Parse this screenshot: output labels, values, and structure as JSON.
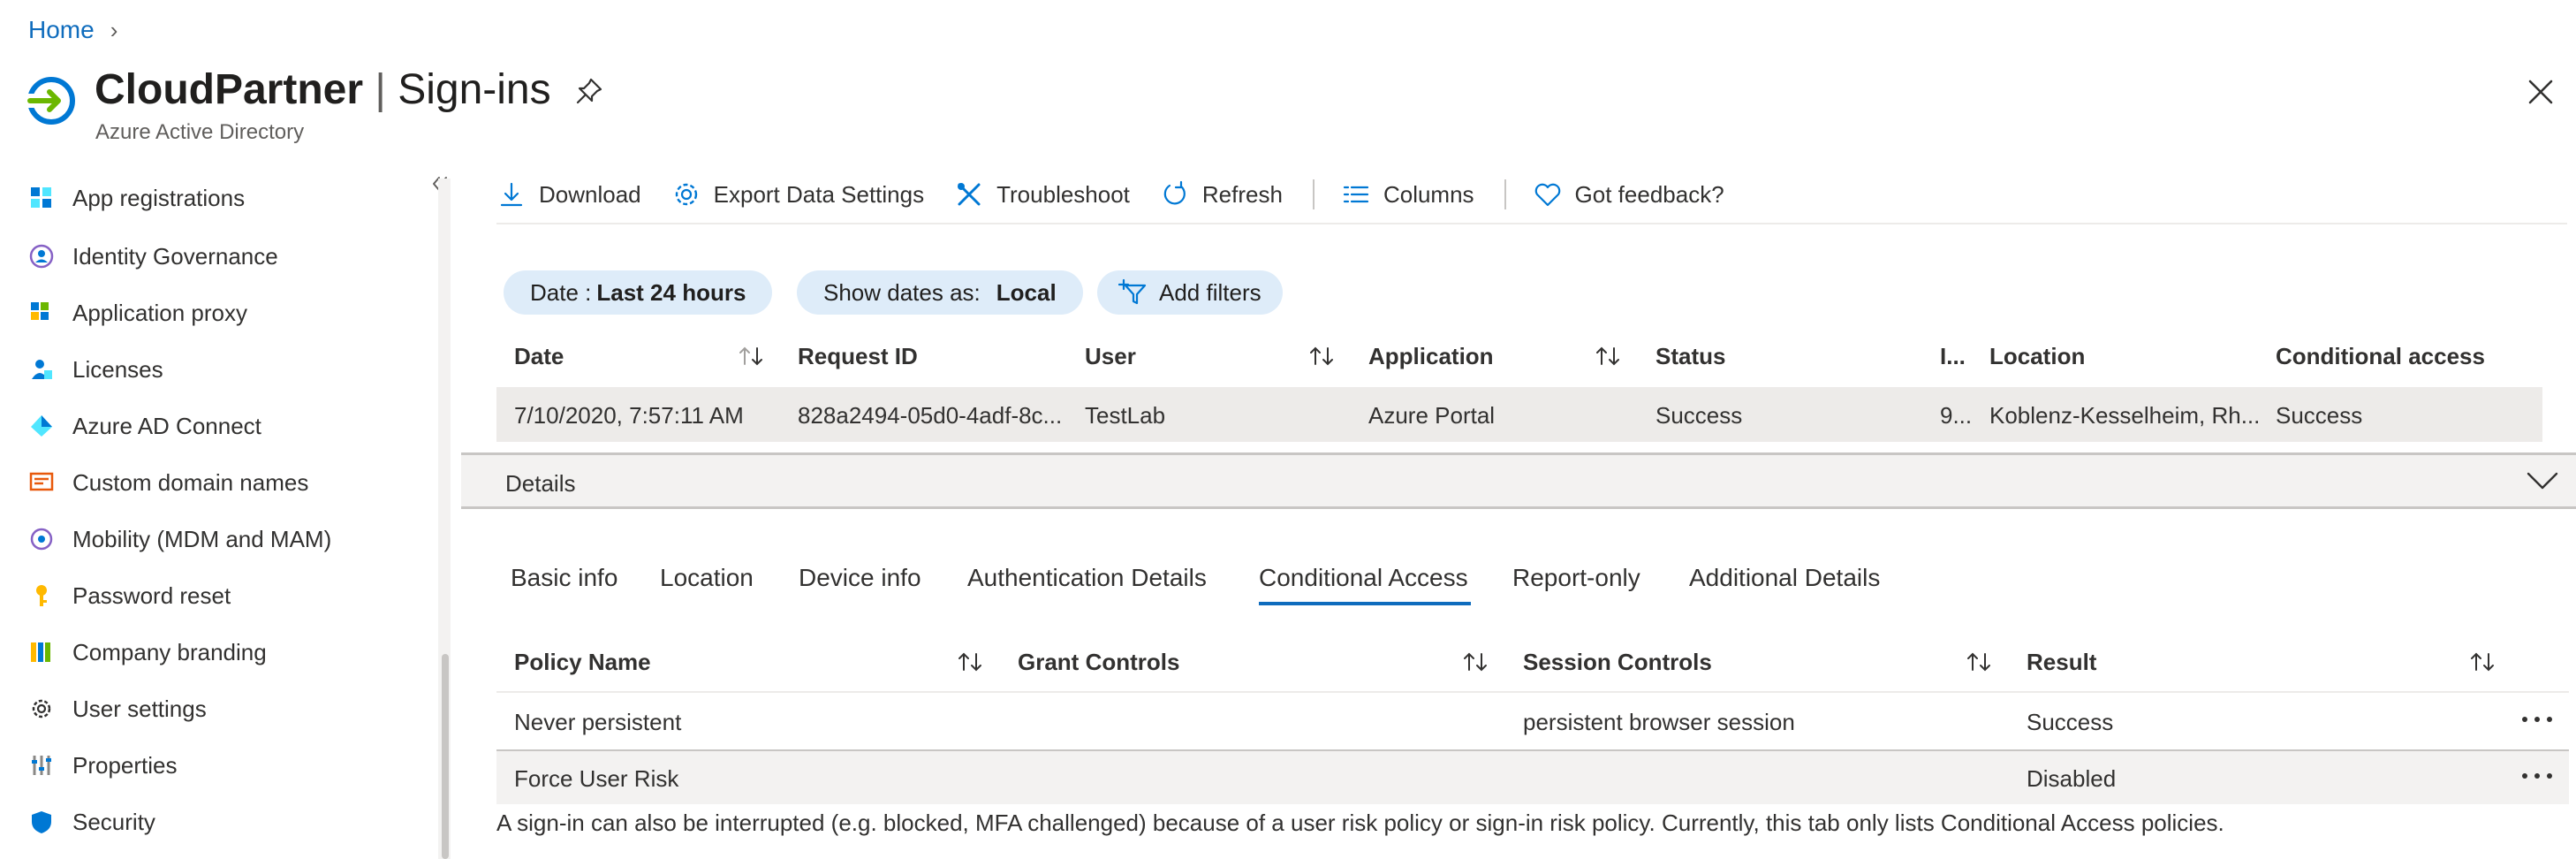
{
  "breadcrumb": {
    "home": "Home",
    "separator": "›"
  },
  "header": {
    "org": "CloudPartner",
    "separator": "|",
    "title": "Sign-ins",
    "subtitle": "Azure Active Directory"
  },
  "sidebar": {
    "items": [
      {
        "label": "App registrations",
        "icon": "app-registrations-icon"
      },
      {
        "label": "Identity Governance",
        "icon": "identity-governance-icon"
      },
      {
        "label": "Application proxy",
        "icon": "application-proxy-icon"
      },
      {
        "label": "Licenses",
        "icon": "licenses-icon"
      },
      {
        "label": "Azure AD Connect",
        "icon": "azure-ad-connect-icon"
      },
      {
        "label": "Custom domain names",
        "icon": "custom-domain-icon"
      },
      {
        "label": "Mobility (MDM and MAM)",
        "icon": "mobility-icon"
      },
      {
        "label": "Password reset",
        "icon": "key-icon"
      },
      {
        "label": "Company branding",
        "icon": "company-branding-icon"
      },
      {
        "label": "User settings",
        "icon": "gear-icon"
      },
      {
        "label": "Properties",
        "icon": "properties-icon"
      },
      {
        "label": "Security",
        "icon": "shield-icon"
      }
    ]
  },
  "toolbar": {
    "download": "Download",
    "export": "Export Data Settings",
    "troubleshoot": "Troubleshoot",
    "refresh": "Refresh",
    "columns": "Columns",
    "feedback": "Got feedback?"
  },
  "filters": {
    "date_label": "Date :",
    "date_value": "Last 24 hours",
    "show_label": "Show dates as:",
    "show_value": "Local",
    "add": "Add filters"
  },
  "signins_table": {
    "columns": [
      "Date",
      "Request ID",
      "User",
      "Application",
      "Status",
      "I...",
      "Location",
      "Conditional access"
    ],
    "rows": [
      {
        "date": "7/10/2020, 7:57:11 AM",
        "request_id": "828a2494-05d0-4adf-8c...",
        "user": "TestLab",
        "application": "Azure Portal",
        "status": "Success",
        "ip": "9...",
        "location": "Koblenz-Kesselheim, Rh...",
        "conditional_access": "Success"
      }
    ]
  },
  "details": {
    "label": "Details",
    "tabs": [
      "Basic info",
      "Location",
      "Device info",
      "Authentication Details",
      "Conditional Access",
      "Report-only",
      "Additional Details"
    ],
    "active_tab": "Conditional Access"
  },
  "policy_table": {
    "columns": [
      "Policy Name",
      "Grant Controls",
      "Session Controls",
      "Result"
    ],
    "rows": [
      {
        "name": "Never persistent",
        "grant": "",
        "session": "persistent browser session",
        "result": "Success"
      },
      {
        "name": "Force User Risk",
        "grant": "",
        "session": "",
        "result": "Disabled"
      }
    ]
  },
  "footnote": "A sign-in can also be interrupted (e.g. blocked, MFA challenged) because of a user risk policy or sign-in risk policy. Currently, this tab only lists Conditional Access policies.",
  "colors": {
    "accent": "#0f6cbd",
    "pill": "#deecf9",
    "row_highlight": "#edebe9"
  }
}
